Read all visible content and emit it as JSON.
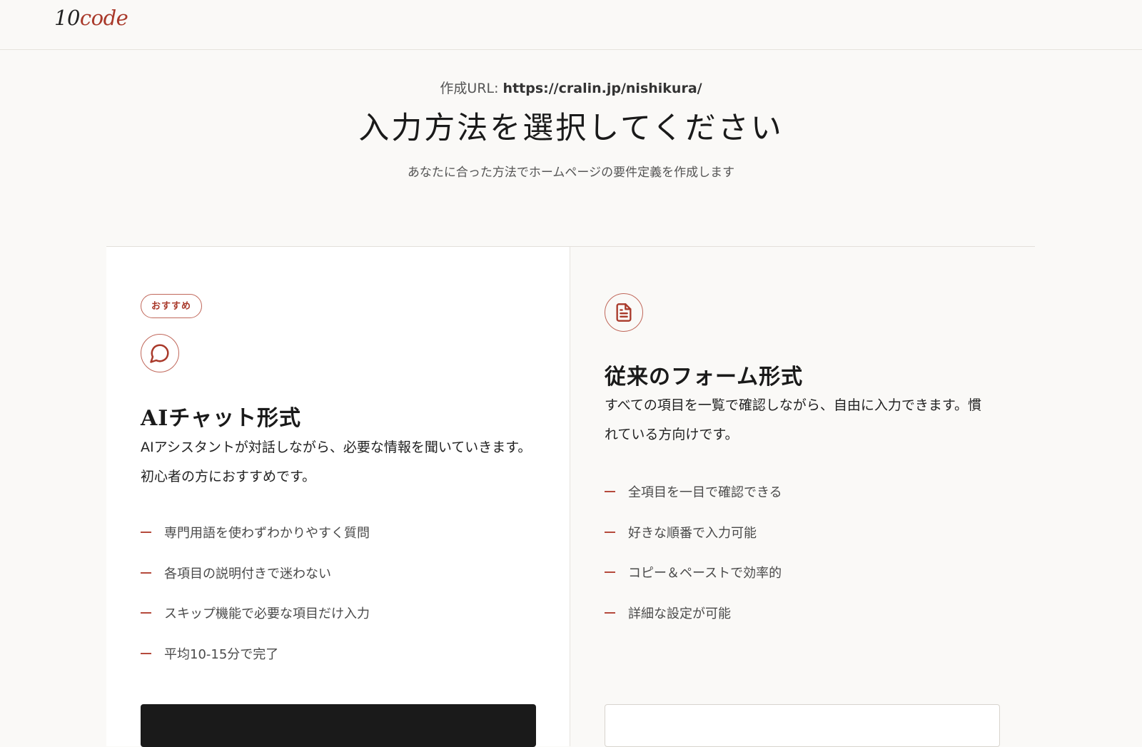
{
  "header": {
    "logo_number": "10",
    "logo_word": "code"
  },
  "intro": {
    "url_label": "作成URL: ",
    "url_value": "https://cralin.jp/nishikura/",
    "title": "入力方法を選択してください",
    "subtitle": "あなたに合った方法でホームページの要件定義を作成します"
  },
  "cards": {
    "ai": {
      "badge": "おすすめ",
      "icon": "chat-bubble-icon",
      "title": "AIチャット形式",
      "desc_line1": "AIアシスタントが対話しながら、必要な情報を聞いていきます。",
      "desc_line2": "初心者の方におすすめです。",
      "features": [
        "専門用語を使わずわかりやすく質問",
        "各項目の説明付きで迷わない",
        "スキップ機能で必要な項目だけ入力",
        "平均10-15分で完了"
      ]
    },
    "form": {
      "icon": "document-icon",
      "title": "従来のフォーム形式",
      "desc_line1": "すべての項目を一覧で確認しながら、自由に入力できます。慣",
      "desc_line2": "れている方向けです。",
      "features": [
        "全項目を一目で確認できる",
        "好きな順番で入力可能",
        "コピー＆ペーストで効率的",
        "詳細な設定が可能"
      ]
    }
  },
  "colors": {
    "accent": "#a9392a",
    "background": "#faf9f7",
    "card_background": "#ffffff",
    "primary_button": "#1a1a1a"
  }
}
